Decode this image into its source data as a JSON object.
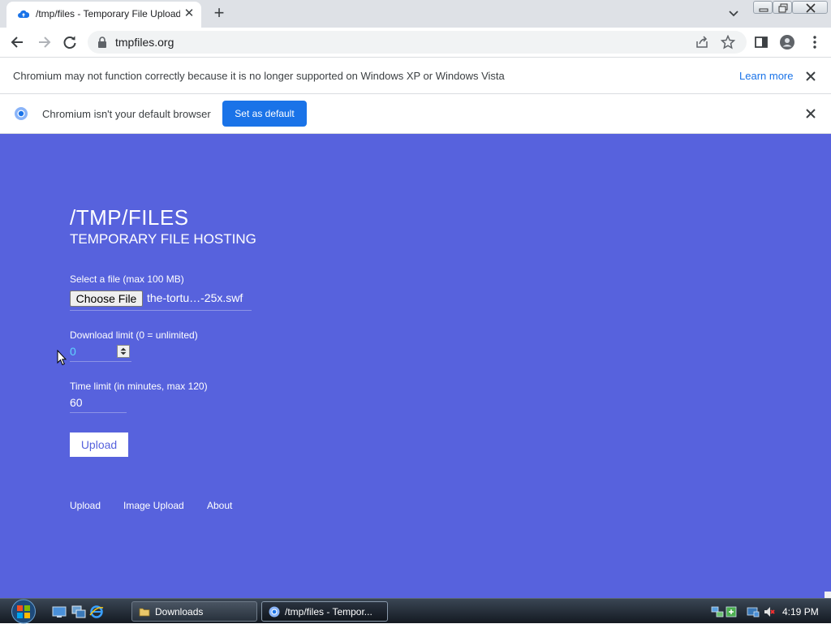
{
  "browser": {
    "tab": {
      "title": "/tmp/files - Temporary File Upload",
      "close": "✕"
    },
    "new_tab": "+",
    "url": "tmpfiles.org"
  },
  "infobars": {
    "unsupported": {
      "text": "Chromium may not function correctly because it is no longer supported on Windows XP or Windows Vista",
      "link": "Learn more"
    },
    "default_browser": {
      "text": "Chromium isn't your default browser",
      "button": "Set as default"
    }
  },
  "site": {
    "title": "/TMP/FILES",
    "subtitle": "TEMPORARY FILE HOSTING"
  },
  "form": {
    "file": {
      "label": "Select a file (max 100 MB)",
      "button": "Choose File",
      "filename": "the-tortu…-25x.swf"
    },
    "download_limit": {
      "label": "Download limit (0 = unlimited)",
      "value": "0"
    },
    "time_limit": {
      "label": "Time limit (in minutes, max 120)",
      "value": "60"
    },
    "submit": "Upload"
  },
  "footer": {
    "links": [
      "Upload",
      "Image Upload",
      "About"
    ]
  },
  "taskbar": {
    "windows": [
      {
        "label": "Downloads",
        "icon": "folder-icon"
      },
      {
        "label": "/tmp/files - Tempor...",
        "icon": "chromium-icon"
      }
    ],
    "clock": "4:19 PM"
  },
  "colors": {
    "page_background": "#5762dd",
    "accent_blue": "#1a73e8",
    "number_text": "#5fd4ff"
  }
}
